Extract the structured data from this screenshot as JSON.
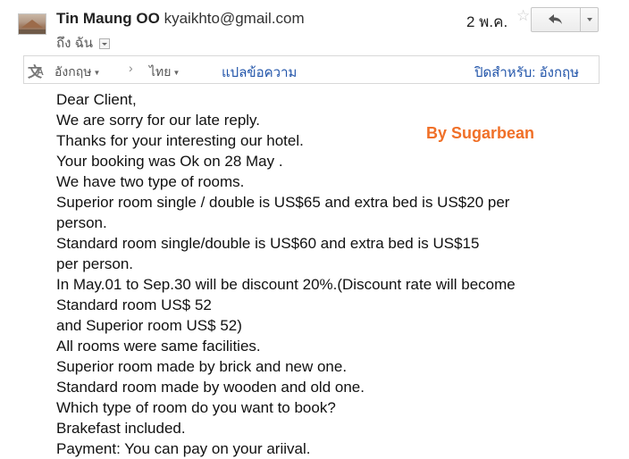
{
  "header": {
    "sender_name": "Tin Maung OO",
    "sender_email": "kyaikhto@gmail.com",
    "to_label": "ถึง ฉัน",
    "date": "2 พ.ค.",
    "star_icon": "☆"
  },
  "translate_bar": {
    "from_language": "อังกฤษ",
    "arrow": "›",
    "to_language": "ไทย",
    "translate_link": "แปลข้อความ",
    "turn_off_link": "ปิดสำหรับ: อังกฤษ",
    "icon_glyph_main": "文",
    "icon_glyph_sub": "A"
  },
  "watermark": "By Sugarbean",
  "message": {
    "lines": [
      "Dear Client,",
      "We are sorry for our late reply.",
      "Thanks for your interesting our hotel.",
      "Your booking was Ok on 28 May .",
      "We have two type of rooms.",
      "Superior room single / double is US$65  and extra bed is US$20 per",
      "person.",
      "Standard  room single/double is US$60 and extra bed is US$15",
      "per person.",
      "In May.01  to Sep.30 will be discount 20%.(Discount rate will become",
      "Standard room US$ 52",
      "and Superior room US$ 52)",
      "All rooms were same facilities.",
      "Superior room made by brick and new one.",
      "Standard room made by wooden and old one.",
      "Which type of room do you want to book?",
      "Brakefast included.",
      "Payment: You can pay on your ariival."
    ]
  }
}
